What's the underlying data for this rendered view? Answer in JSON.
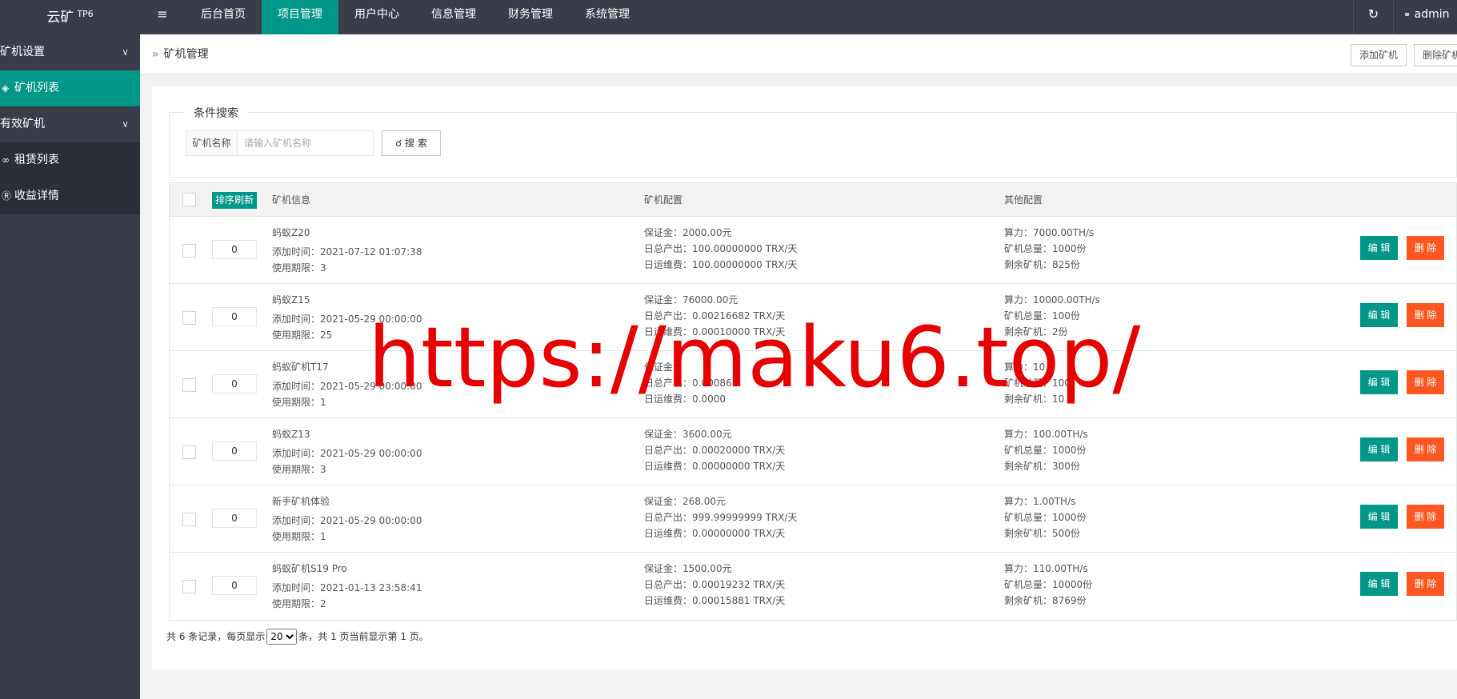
{
  "topbar": {
    "logo": "云矿",
    "logo_sup": "TP6",
    "menu_toggle_icon": "≡",
    "nav": [
      {
        "label": "后台首页",
        "active": false
      },
      {
        "label": "项目管理",
        "active": true
      },
      {
        "label": "用户中心",
        "active": false
      },
      {
        "label": "信息管理",
        "active": false
      },
      {
        "label": "财务管理",
        "active": false
      },
      {
        "label": "系统管理",
        "active": false
      }
    ],
    "refresh_icon": "↻",
    "user_icon": "👤",
    "user": "admin"
  },
  "sidebar": {
    "group1": "矿机设置",
    "item_machine_list": "矿机列表",
    "group2": "有效矿机",
    "item_rent_list": "租赁列表",
    "item_income": "收益详情"
  },
  "breadcrumb": {
    "label": "矿机管理",
    "add_btn": "添加矿机",
    "delete_btn": "删除矿机"
  },
  "search": {
    "legend": "条件搜索",
    "label": "矿机名称",
    "placeholder": "请输入矿机名称",
    "button": "搜 索"
  },
  "table": {
    "sort_btn": "排序刷新",
    "col_info": "矿机信息",
    "col_config": "矿机配置",
    "col_other": "其他配置",
    "edit_label": "编 辑",
    "delete_label": "删 除",
    "rows": [
      {
        "order": "0",
        "name": "蚂蚁Z20",
        "added": "添加时间：2021-07-12 01:07:38",
        "period": "使用期限：3",
        "deposit": "保证金：2000.00元",
        "daily_output": "日总产出：100.00000000 TRX/天",
        "daily_fee": "日运维费：100.00000000 TRX/天",
        "power": "算力：7000.00TH/s",
        "total": "矿机总量：1000份",
        "remain": "剩余矿机：825份"
      },
      {
        "order": "0",
        "name": "蚂蚁Z15",
        "added": "添加时间：2021-05-29 00:00:00",
        "period": "使用期限：25",
        "deposit": "保证金：76000.00元",
        "daily_output": "日总产出：0.00216682 TRX/天",
        "daily_fee": "日运维费：0.00010000 TRX/天",
        "power": "算力：10000.00TH/s",
        "total": "矿机总量：100份",
        "remain": "剩余矿机：2份"
      },
      {
        "order": "0",
        "name": "蚂蚁矿机T17",
        "added": "添加时间：2021-05-29 00:00:00",
        "period": "使用期限：1",
        "deposit": "保证金：",
        "daily_output": "日总产出：0.00086",
        "daily_fee": "日运维费：0.0000",
        "power": "算力：10",
        "total": "矿机总量：100",
        "remain": "剩余矿机：10"
      },
      {
        "order": "0",
        "name": "蚂蚁Z13",
        "added": "添加时间：2021-05-29 00:00:00",
        "period": "使用期限：3",
        "deposit": "保证金：3600.00元",
        "daily_output": "日总产出：0.00020000 TRX/天",
        "daily_fee": "日运维费：0.00000000 TRX/天",
        "power": "算力：100.00TH/s",
        "total": "矿机总量：1000份",
        "remain": "剩余矿机：300份"
      },
      {
        "order": "0",
        "name": "新手矿机体验",
        "added": "添加时间：2021-05-29 00:00:00",
        "period": "使用期限：1",
        "deposit": "保证金：268.00元",
        "daily_output": "日总产出：999.99999999 TRX/天",
        "daily_fee": "日运维费：0.00000000 TRX/天",
        "power": "算力：1.00TH/s",
        "total": "矿机总量：1000份",
        "remain": "剩余矿机：500份"
      },
      {
        "order": "0",
        "name": "蚂蚁矿机S19 Pro",
        "added": "添加时间：2021-01-13 23:58:41",
        "period": "使用期限：2",
        "deposit": "保证金：1500.00元",
        "daily_output": "日总产出：0.00019232 TRX/天",
        "daily_fee": "日运维费：0.00015881 TRX/天",
        "power": "算力：110.00TH/s",
        "total": "矿机总量：10000份",
        "remain": "剩余矿机：8769份"
      }
    ]
  },
  "pager": {
    "prefix": "共 6 条记录，每页显示",
    "per_page": "20",
    "suffix": "条，共 1 页当前显示第 1 页。"
  },
  "watermark": "https://maku6.top/",
  "colors": {
    "accent": "#009688",
    "danger": "#ff5722",
    "dark": "#393d49",
    "watermark": "#e60000"
  }
}
